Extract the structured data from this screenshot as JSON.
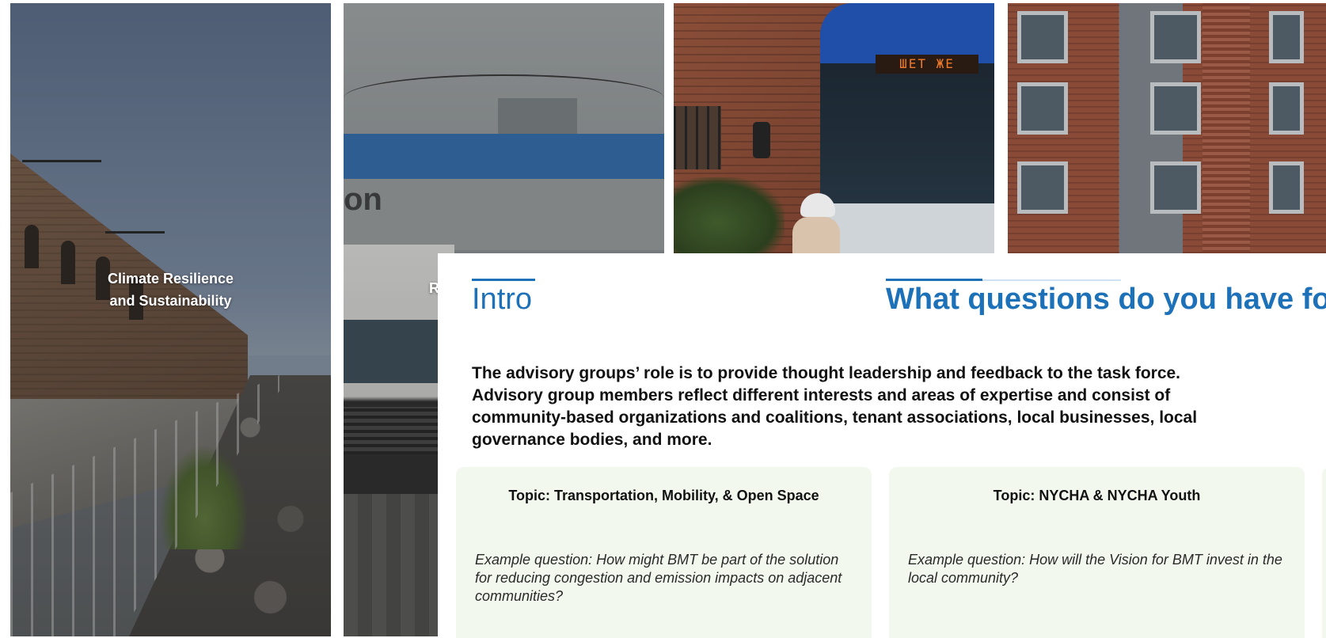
{
  "tiles": [
    {
      "label_line1": "Climate Resilience",
      "label_line2": "and Sustainability"
    },
    {
      "label_partial": "R"
    }
  ],
  "bus_sign": "ШЕТ ЖЕ",
  "truck_sign": "on",
  "card": {
    "intro_title": "Intro",
    "questions_title": "What questions do you have for",
    "intro_body": "The advisory groups’ role is to provide thought leadership and feedback to the task force. Advisory group members reflect different interests and areas of expertise and consist of community-based organizations and coalitions, tenant associations, local businesses, local governance bodies, and more.",
    "topics": [
      {
        "title": "Topic: Transportation, Mobility, & Open Space",
        "example": "Example question: How might BMT be part of the solution for reducing congestion and emission impacts on adjacent communities?"
      },
      {
        "title": "Topic: NYCHA & NYCHA Youth",
        "example": "Example question: How will the Vision for BMT invest in the local community?"
      }
    ]
  },
  "colors": {
    "accent_blue": "#1c71b8",
    "topic_card_bg": "#f2f8ee"
  }
}
